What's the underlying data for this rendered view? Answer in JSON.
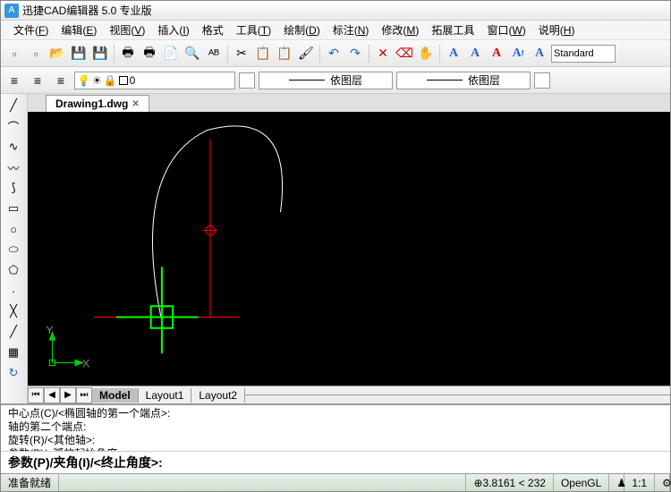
{
  "app": {
    "title": "迅捷CAD编辑器 5.0 专业版",
    "icon": "A"
  },
  "menu": [
    {
      "label": "文件",
      "key": "F"
    },
    {
      "label": "编辑",
      "key": "E"
    },
    {
      "label": "视图",
      "key": "V"
    },
    {
      "label": "插入",
      "key": "I"
    },
    {
      "label": "格式",
      "key": ""
    },
    {
      "label": "工具",
      "key": "T"
    },
    {
      "label": "绘制",
      "key": "D"
    },
    {
      "label": "标注",
      "key": "N"
    },
    {
      "label": "修改",
      "key": "M"
    },
    {
      "label": "拓展工具",
      "key": ""
    },
    {
      "label": "窗口",
      "key": "W"
    },
    {
      "label": "说明",
      "key": "H"
    }
  ],
  "textStyle": "Standard",
  "layer": {
    "name": "0",
    "bylayer1": "依图层",
    "bylayer2": "依图层"
  },
  "fileTab": "Drawing1.dwg",
  "modelTabs": {
    "active": "Model",
    "items": [
      "Model",
      "Layout1",
      "Layout2"
    ]
  },
  "command": {
    "history": [
      "中心点(C)/<椭圆轴的第一个端点>:",
      "轴的第二个端点:",
      "旋转(R)/<其他轴>:",
      "参数(P)/<弧的起始角度>:"
    ],
    "prompt": "参数(P)/夹角(I)/<终止角度>:"
  },
  "status": {
    "ready": "准备就绪",
    "coords": "3.8161 < 232",
    "render": "OpenGL",
    "scale": "1:1"
  }
}
